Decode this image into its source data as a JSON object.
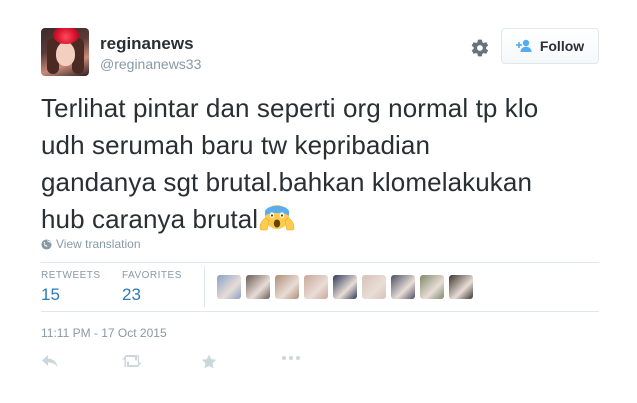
{
  "user": {
    "name": "reginanews",
    "handle": "@reginanews33"
  },
  "follow_button": {
    "label": "Follow"
  },
  "tweet": {
    "lines": [
      "Terlihat pintar dan seperti org normal tp klo",
      "udh serumah baru tw kepribadian",
      "gandanya sgt brutal.bahkan klomelakukan",
      "hub caranya brutal"
    ],
    "emoji": "screaming-face-emoji"
  },
  "view_translation": "View translation",
  "stats": {
    "retweets_label": "RETWEETS",
    "retweets_value": "15",
    "favorites_label": "FAVORITES",
    "favorites_value": "23"
  },
  "favoriter_avatar_colors": [
    "#8aa0c6",
    "#6b5b55",
    "#b08c78",
    "#c9a79a",
    "#2f3a5a",
    "#d7c2b8",
    "#4b4e63",
    "#7f8a6b",
    "#3b3530"
  ],
  "timestamp": "11:11 PM - 17 Oct 2015",
  "actions": [
    "reply-icon",
    "retweet-icon",
    "favorite-icon",
    "more-icon"
  ]
}
